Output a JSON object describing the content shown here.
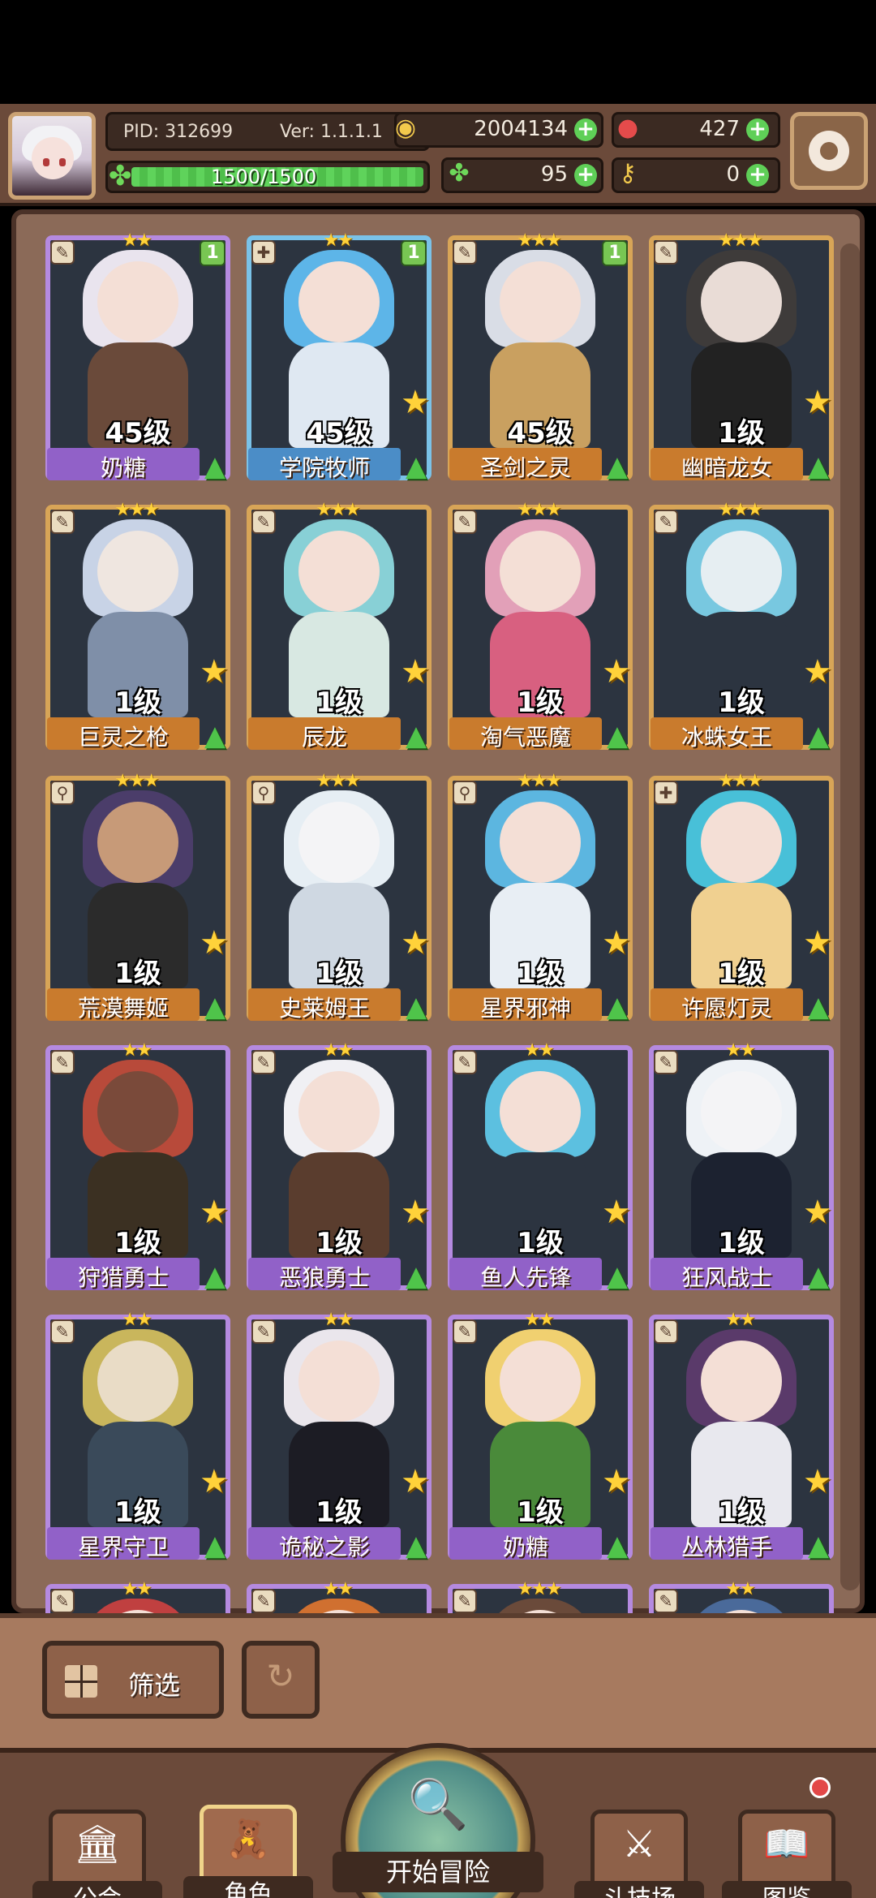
{
  "header": {
    "pid": "PID: 312699",
    "version": "Ver: 1.1.1.1",
    "exp": "1500/1500",
    "gold": "2004134",
    "gems": "427",
    "clover": "95",
    "keys": "0"
  },
  "icons": {
    "gold": "coin-icon",
    "gems": "ruby-icon",
    "clover": "clover-icon",
    "keys": "key-icon",
    "settings": "gear-icon"
  },
  "cards": [
    {
      "name": "奶糖",
      "level": "45级",
      "stars": "★★",
      "badge": "1",
      "frame": "purple",
      "cls": "✎"
    },
    {
      "name": "学院牧师",
      "level": "45级",
      "stars": "★★",
      "badge": "1",
      "frame": "blue",
      "cls": "✚",
      "fav": true
    },
    {
      "name": "圣剑之灵",
      "level": "45级",
      "stars": "★★★",
      "badge": "1",
      "frame": "gold",
      "cls": "✎"
    },
    {
      "name": "幽暗龙女",
      "level": "1级",
      "stars": "★★★",
      "badge": "",
      "frame": "gold",
      "cls": "✎",
      "fav": true
    },
    {
      "name": "巨灵之枪",
      "level": "1级",
      "stars": "★★★",
      "badge": "",
      "frame": "gold",
      "cls": "✎",
      "fav": true
    },
    {
      "name": "辰龙",
      "level": "1级",
      "stars": "★★★",
      "badge": "",
      "frame": "gold",
      "cls": "✎",
      "fav": true
    },
    {
      "name": "淘气恶魔",
      "level": "1级",
      "stars": "★★★",
      "badge": "",
      "frame": "gold",
      "cls": "✎",
      "fav": true
    },
    {
      "name": "冰蛛女王",
      "level": "1级",
      "stars": "★★★",
      "badge": "",
      "frame": "gold",
      "cls": "✎",
      "fav": true
    },
    {
      "name": "荒漠舞姬",
      "level": "1级",
      "stars": "★★★",
      "badge": "",
      "frame": "gold",
      "cls": "⚲",
      "fav": true
    },
    {
      "name": "史莱姆王",
      "level": "1级",
      "stars": "★★★",
      "badge": "",
      "frame": "gold",
      "cls": "⚲",
      "fav": true
    },
    {
      "name": "星界邪神",
      "level": "1级",
      "stars": "★★★",
      "badge": "",
      "frame": "gold",
      "cls": "⚲",
      "fav": true
    },
    {
      "name": "许愿灯灵",
      "level": "1级",
      "stars": "★★★",
      "badge": "",
      "frame": "gold",
      "cls": "✚",
      "fav": true
    },
    {
      "name": "狩猎勇士",
      "level": "1级",
      "stars": "★★",
      "badge": "",
      "frame": "purple",
      "cls": "✎",
      "fav": true
    },
    {
      "name": "恶狼勇士",
      "level": "1级",
      "stars": "★★",
      "badge": "",
      "frame": "purple",
      "cls": "✎",
      "fav": true
    },
    {
      "name": "鱼人先锋",
      "level": "1级",
      "stars": "★★",
      "badge": "",
      "frame": "purple",
      "cls": "✎",
      "fav": true
    },
    {
      "name": "狂风战士",
      "level": "1级",
      "stars": "★★",
      "badge": "",
      "frame": "purple",
      "cls": "✎",
      "fav": true
    },
    {
      "name": "星界守卫",
      "level": "1级",
      "stars": "★★",
      "badge": "",
      "frame": "purple",
      "cls": "✎",
      "fav": true
    },
    {
      "name": "诡秘之影",
      "level": "1级",
      "stars": "★★",
      "badge": "",
      "frame": "purple",
      "cls": "✎",
      "fav": true
    },
    {
      "name": "奶糖",
      "level": "1级",
      "stars": "★★",
      "badge": "",
      "frame": "purple",
      "cls": "✎",
      "fav": true
    },
    {
      "name": "丛林猎手",
      "level": "1级",
      "stars": "★★",
      "badge": "",
      "frame": "purple",
      "cls": "✎",
      "fav": true
    },
    {
      "name": "",
      "level": "",
      "stars": "★★",
      "badge": "",
      "frame": "purple",
      "cls": "✎"
    },
    {
      "name": "",
      "level": "",
      "stars": "★★",
      "badge": "",
      "frame": "purple",
      "cls": "✎"
    },
    {
      "name": "",
      "level": "",
      "stars": "★★★",
      "badge": "",
      "frame": "purple",
      "cls": "✎"
    },
    {
      "name": "",
      "level": "",
      "stars": "★★",
      "badge": "",
      "frame": "purple",
      "cls": "✎"
    }
  ],
  "filter": {
    "label": "筛选"
  },
  "nav": {
    "guild": "公会",
    "characters": "角色",
    "adventure": "开始冒险",
    "arena": "斗技场",
    "codex": "图鉴"
  },
  "colors": {
    "gold_frame": "#d8a557",
    "purple_frame": "#b58ae0",
    "blue_frame": "#7ac2e8",
    "level_up": "#4fc44a",
    "favorite_star": "#ffd23a"
  }
}
